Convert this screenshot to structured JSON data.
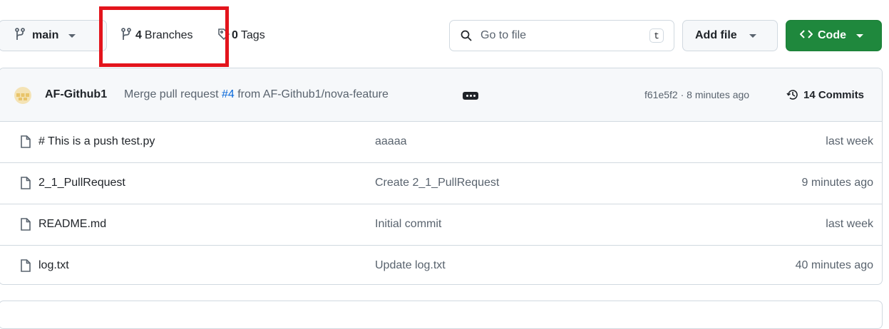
{
  "toolbar": {
    "branch_selector": {
      "label": "main",
      "icon": "git-branch-icon"
    },
    "branches_link": {
      "count": "4",
      "label": "Branches",
      "icon": "git-branch-icon"
    },
    "tags_link": {
      "count": "0",
      "label": "Tags",
      "icon": "tag-icon"
    },
    "search": {
      "placeholder": "Go to file",
      "shortcut": "t",
      "icon": "search-icon"
    },
    "add_file_label": "Add file",
    "code_label": "Code",
    "code_icon": "code-icon",
    "accent_green": "#1f883d",
    "highlight_color": "#e3141c"
  },
  "latest_commit": {
    "author": "AF-Github1",
    "message_prefix": "Merge pull request",
    "pr_number": "#4",
    "message_suffix": "from AF-Github1/nova-feature",
    "hash_time": "f61e5f2 · 8 minutes ago",
    "commits_count": "14 Commits"
  },
  "files": [
    {
      "name": "# This is a push test.py",
      "message": "aaaaa",
      "date": "last week"
    },
    {
      "name": "2_1_PullRequest",
      "message": "Create 2_1_PullRequest",
      "date": "9 minutes ago"
    },
    {
      "name": "README.md",
      "message": "Initial commit",
      "date": "last week"
    },
    {
      "name": "log.txt",
      "message": "Update log.txt",
      "date": "40 minutes ago"
    }
  ]
}
